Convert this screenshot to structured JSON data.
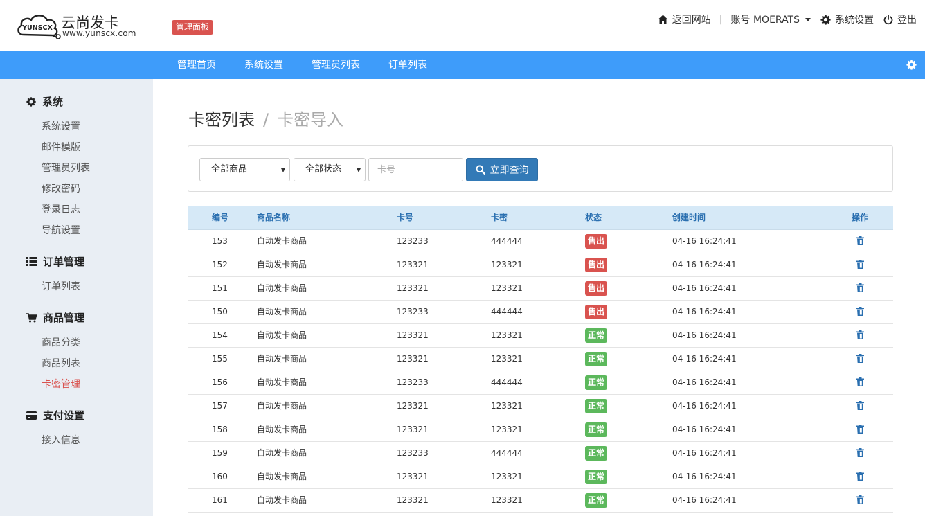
{
  "header": {
    "logo_mark_text": "YUNSCX",
    "logo_title": "云尚发卡",
    "logo_url": "www.yunscx.com",
    "admin_badge": "管理面板",
    "back_site": "返回网站",
    "separator": "|",
    "account": "账号 MOERATS",
    "settings": "系统设置",
    "logout": "登出"
  },
  "topnav": {
    "items": [
      "管理首页",
      "系统设置",
      "管理员列表",
      "订单列表"
    ]
  },
  "sidebar": {
    "groups": [
      {
        "title": "系统",
        "icon": "gear-icon",
        "items": [
          "系统设置",
          "邮件模版",
          "管理员列表",
          "修改密码",
          "登录日志",
          "导航设置"
        ]
      },
      {
        "title": "订单管理",
        "icon": "list-icon",
        "items": [
          "订单列表"
        ]
      },
      {
        "title": "商品管理",
        "icon": "cart-icon",
        "items": [
          "商品分类",
          "商品列表",
          "卡密管理"
        ]
      },
      {
        "title": "支付设置",
        "icon": "credit-card-icon",
        "items": [
          "接入信息"
        ]
      }
    ],
    "active_item": "卡密管理"
  },
  "page": {
    "title": "卡密列表",
    "title_sep": "/",
    "subtitle": "卡密导入"
  },
  "filter": {
    "product_select": "全部商品",
    "status_select": "全部状态",
    "card_placeholder": "卡号",
    "search_button": "立即查询"
  },
  "table": {
    "columns": [
      "编号",
      "商品名称",
      "卡号",
      "卡密",
      "状态",
      "创建时间",
      "操作"
    ],
    "rows": [
      {
        "id": "153",
        "product": "自动发卡商品",
        "card": "123233",
        "secret": "444444",
        "status": "售出",
        "status_type": "sold",
        "created": "04-16 16:24:41"
      },
      {
        "id": "152",
        "product": "自动发卡商品",
        "card": "123321",
        "secret": "123321",
        "status": "售出",
        "status_type": "sold",
        "created": "04-16 16:24:41"
      },
      {
        "id": "151",
        "product": "自动发卡商品",
        "card": "123321",
        "secret": "123321",
        "status": "售出",
        "status_type": "sold",
        "created": "04-16 16:24:41"
      },
      {
        "id": "150",
        "product": "自动发卡商品",
        "card": "123233",
        "secret": "444444",
        "status": "售出",
        "status_type": "sold",
        "created": "04-16 16:24:41"
      },
      {
        "id": "154",
        "product": "自动发卡商品",
        "card": "123321",
        "secret": "123321",
        "status": "正常",
        "status_type": "ok",
        "created": "04-16 16:24:41"
      },
      {
        "id": "155",
        "product": "自动发卡商品",
        "card": "123321",
        "secret": "123321",
        "status": "正常",
        "status_type": "ok",
        "created": "04-16 16:24:41"
      },
      {
        "id": "156",
        "product": "自动发卡商品",
        "card": "123233",
        "secret": "444444",
        "status": "正常",
        "status_type": "ok",
        "created": "04-16 16:24:41"
      },
      {
        "id": "157",
        "product": "自动发卡商品",
        "card": "123321",
        "secret": "123321",
        "status": "正常",
        "status_type": "ok",
        "created": "04-16 16:24:41"
      },
      {
        "id": "158",
        "product": "自动发卡商品",
        "card": "123321",
        "secret": "123321",
        "status": "正常",
        "status_type": "ok",
        "created": "04-16 16:24:41"
      },
      {
        "id": "159",
        "product": "自动发卡商品",
        "card": "123233",
        "secret": "444444",
        "status": "正常",
        "status_type": "ok",
        "created": "04-16 16:24:41"
      },
      {
        "id": "160",
        "product": "自动发卡商品",
        "card": "123321",
        "secret": "123321",
        "status": "正常",
        "status_type": "ok",
        "created": "04-16 16:24:41"
      },
      {
        "id": "161",
        "product": "自动发卡商品",
        "card": "123321",
        "secret": "123321",
        "status": "正常",
        "status_type": "ok",
        "created": "04-16 16:24:41"
      }
    ],
    "action_icon": "trash-icon"
  },
  "colors": {
    "nav_blue": "#3e9cfa",
    "sidebar_bg": "#e9eef4",
    "danger": "#d9534f",
    "success": "#5cb85c",
    "primary": "#337ab7",
    "table_header": "#d6e9f7"
  }
}
